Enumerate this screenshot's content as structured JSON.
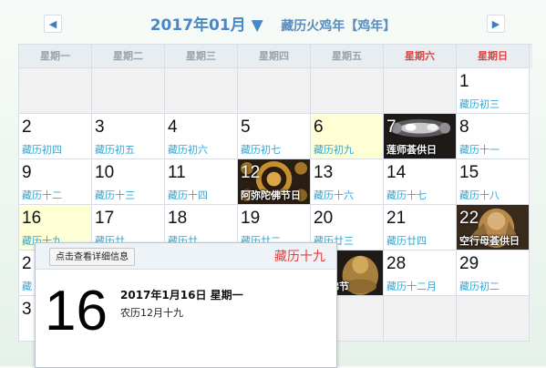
{
  "nav": {
    "prev_icon": "left-triangle-icon",
    "next_icon": "right-triangle-icon",
    "prev": "◀",
    "next": "▶"
  },
  "header": {
    "month": "2017年01月 ▼",
    "year_name": "藏历火鸡年【鸡年】"
  },
  "weekdays": [
    "星期一",
    "星期二",
    "星期三",
    "星期四",
    "星期五",
    "星期六",
    "星期日"
  ],
  "colors": {
    "weekend": "#e0413c",
    "lunar": "#33a7d5",
    "accent": "#4a87c4"
  },
  "cells": {
    "d1": {
      "num": "1",
      "lunar": "藏历初三"
    },
    "d2": {
      "num": "2",
      "lunar": "藏历初四"
    },
    "d3": {
      "num": "3",
      "lunar": "藏历初五"
    },
    "d4": {
      "num": "4",
      "lunar": "藏历初六"
    },
    "d5": {
      "num": "5",
      "lunar": "藏历初七"
    },
    "d6": {
      "num": "6",
      "lunar": "藏历初九"
    },
    "d7": {
      "num": "7",
      "festival": "莲师荟供日"
    },
    "d8": {
      "num": "8",
      "lunar": "藏历十一"
    },
    "d9": {
      "num": "9",
      "lunar": "藏历十二"
    },
    "d10": {
      "num": "10",
      "lunar": "藏历十三"
    },
    "d11": {
      "num": "11",
      "lunar": "藏历十四"
    },
    "d12": {
      "num": "12",
      "festival": "阿弥陀佛节日"
    },
    "d13": {
      "num": "13",
      "lunar": "藏历十六"
    },
    "d14": {
      "num": "14",
      "lunar": "藏历十七"
    },
    "d15": {
      "num": "15",
      "lunar": "藏历十八"
    },
    "d16": {
      "num": "16",
      "lunar": "藏历十九"
    },
    "d17": {
      "num": "17",
      "lunar": "藏历廿"
    },
    "d18": {
      "num": "18",
      "lunar": "藏历廿"
    },
    "d19": {
      "num": "19",
      "lunar": "藏历廿二"
    },
    "d20": {
      "num": "20",
      "lunar": "藏历廿三"
    },
    "d21": {
      "num": "21",
      "lunar": "藏历廿四"
    },
    "d22": {
      "num": "22",
      "festival": "空行母荟供日"
    },
    "d23": {
      "num": "2",
      "lunar": "藏"
    },
    "d24": {
      "num": "",
      "lunar": ""
    },
    "d25": {
      "num": "",
      "lunar": ""
    },
    "d26": {
      "num": "",
      "lunar": ""
    },
    "d27": {
      "num": "",
      "festival": "牟尼佛节"
    },
    "d28": {
      "num": "28",
      "lunar": "藏历十二月"
    },
    "d29": {
      "num": "29",
      "lunar": "藏历初二"
    },
    "d30": {
      "num": "3",
      "lunar": ""
    }
  },
  "popup": {
    "button": "点击查看详细信息",
    "lunar": "藏历十九",
    "day": "16",
    "date": "2017年1月16日  星期一",
    "nongli": "农历12月十九"
  }
}
